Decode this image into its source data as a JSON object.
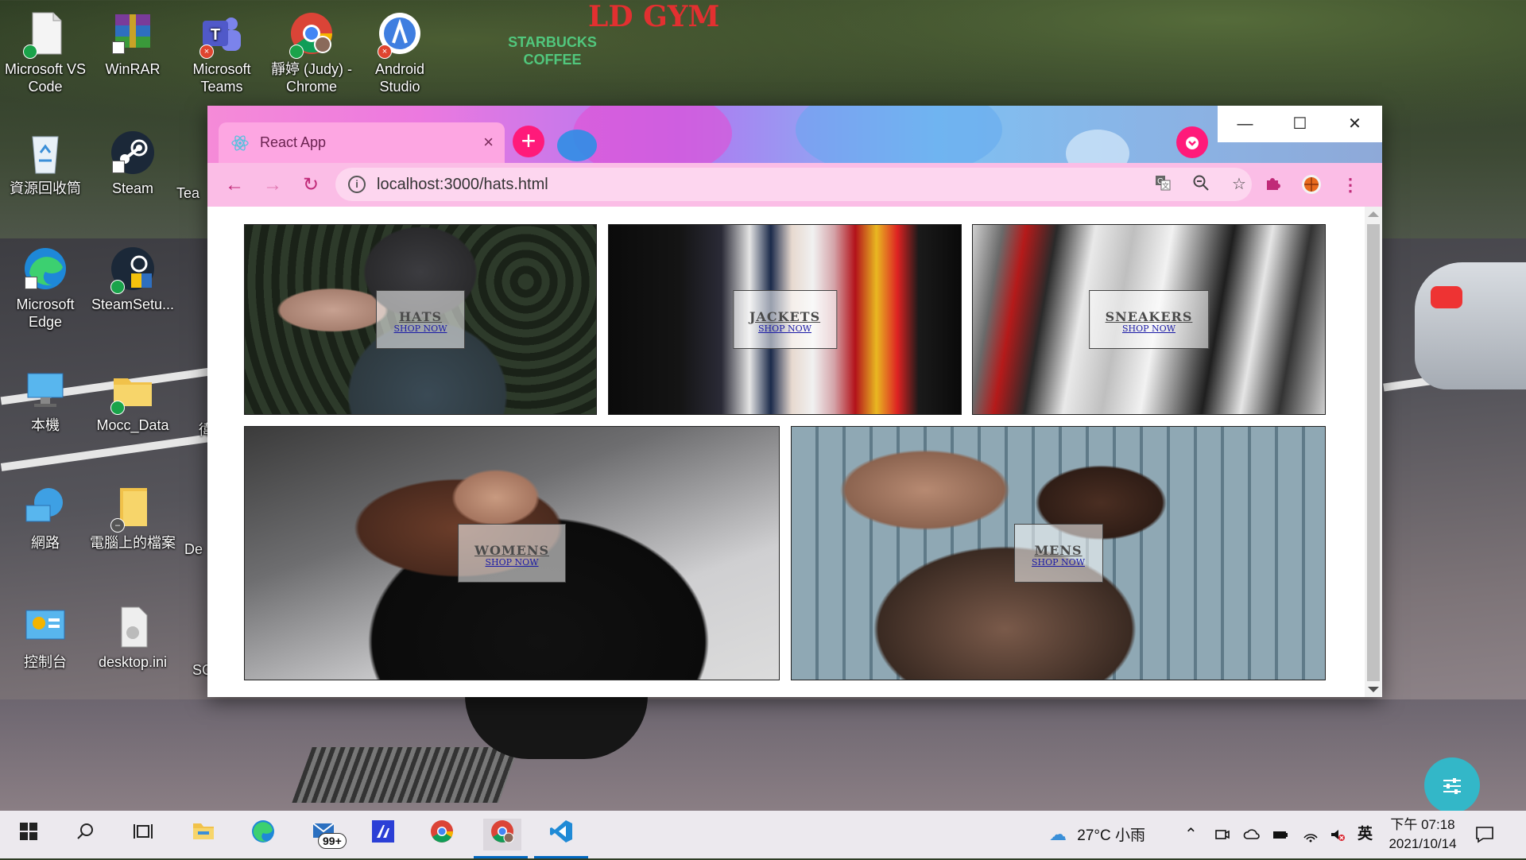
{
  "desktop": {
    "background_sign_gym": "LD GYM",
    "background_sign_starbucks": "STARBUCKS COFFEE",
    "icons": [
      {
        "label": "Microsoft VS Code",
        "icon": "vscode-file-icon",
        "badge": "ok"
      },
      {
        "label": "WinRAR",
        "icon": "winrar-icon",
        "badge": "none"
      },
      {
        "label": "Microsoft Teams",
        "icon": "teams-icon",
        "badge": "x"
      },
      {
        "label": "靜婷 (Judy) - Chrome",
        "icon": "chrome-profile-icon",
        "badge": "ok"
      },
      {
        "label": "Android Studio",
        "icon": "android-studio-icon",
        "badge": "x"
      },
      {
        "label": "資源回收筒",
        "icon": "recycle-bin-icon",
        "badge": "none"
      },
      {
        "label": "Steam",
        "icon": "steam-icon",
        "badge": "none"
      },
      {
        "label": "Microsoft Edge",
        "icon": "edge-icon",
        "badge": "none"
      },
      {
        "label": "SteamSetu...",
        "icon": "steam-setup-icon",
        "badge": "ok"
      },
      {
        "label": "本機",
        "icon": "this-pc-icon",
        "badge": "none"
      },
      {
        "label": "Mocc_Data",
        "icon": "folder-icon",
        "badge": "ok"
      },
      {
        "label": "網路",
        "icon": "network-icon",
        "badge": "none"
      },
      {
        "label": "電腦上的檔案",
        "icon": "folder-icon",
        "badge": "sync"
      },
      {
        "label": "控制台",
        "icon": "control-panel-icon",
        "badge": "none"
      },
      {
        "label": "desktop.ini",
        "icon": "ini-file-icon",
        "badge": "none"
      }
    ],
    "partial_labels": [
      "Tea",
      "De",
      "SC",
      "徫"
    ]
  },
  "browser": {
    "tab": {
      "title": "React App",
      "favicon": "react-icon",
      "close": "×"
    },
    "new_tab": "+",
    "window_controls": {
      "minimize": "—",
      "maximize": "☐",
      "close": "✕"
    },
    "url": "localhost:3000/hats.html",
    "toolbar_icons": [
      "translate-icon",
      "zoom-out-icon",
      "bookmark-star-icon",
      "extensions-icon",
      "profile-avatar-icon",
      "menu-kebab-icon"
    ]
  },
  "page": {
    "categories": [
      {
        "title": "HATS",
        "cta": "SHOP NOW"
      },
      {
        "title": "JACKETS",
        "cta": "SHOP NOW"
      },
      {
        "title": "SNEAKERS",
        "cta": "SHOP NOW"
      },
      {
        "title": "WOMENS",
        "cta": "SHOP NOW"
      },
      {
        "title": "MENS",
        "cta": "SHOP NOW"
      }
    ]
  },
  "taskbar": {
    "apps": [
      "start-icon",
      "search-icon",
      "task-view-icon",
      "file-explorer-icon",
      "edge-icon",
      "mail-icon",
      "visual-studio-icon",
      "chrome-icon",
      "chrome-profile-icon",
      "vscode-icon"
    ],
    "mail_badge": "99+",
    "weather": "27°C 小雨",
    "ime": "英",
    "time": "下午 07:18",
    "date": "2021/10/14"
  },
  "colors": {
    "accent_pink": "#ff1a7a",
    "tab_pink": "#fda6e2",
    "toolbar_pink": "#fbbde6",
    "link_blue": "#1a1aa6",
    "assistant_teal": "#33b7c8"
  }
}
